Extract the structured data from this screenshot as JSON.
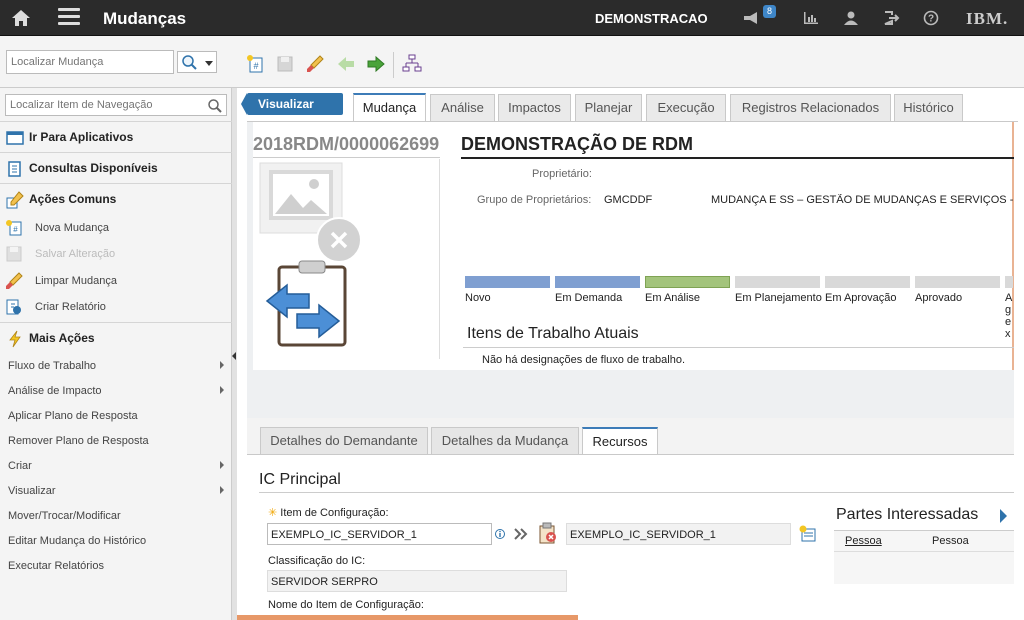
{
  "topbar": {
    "app_title": "Mudanças",
    "user_context": "DEMONSTRACAO",
    "notification_count": "8",
    "brand": "IBM."
  },
  "toolbar": {
    "search_placeholder": "Localizar Mudança"
  },
  "sidebar": {
    "search_placeholder": "Localizar Item de Navegação",
    "sections": {
      "go_to_apps": "Ir Para Aplicativos",
      "queries": "Consultas Disponíveis",
      "common_actions": "Ações Comuns",
      "more_actions": "Mais Ações"
    },
    "common_items": [
      "Nova Mudança",
      "Salvar Alteração",
      "Limpar Mudança",
      "Criar Relatório"
    ],
    "more_items": [
      {
        "label": "Fluxo de Trabalho",
        "submenu": true
      },
      {
        "label": "Análise de Impacto",
        "submenu": true
      },
      {
        "label": "Aplicar Plano de Resposta",
        "submenu": false
      },
      {
        "label": "Remover Plano de Resposta",
        "submenu": false
      },
      {
        "label": "Criar",
        "submenu": true
      },
      {
        "label": "Visualizar",
        "submenu": true
      },
      {
        "label": "Mover/Trocar/Modificar",
        "submenu": false
      },
      {
        "label": "Editar Mudança do Histórico",
        "submenu": false
      },
      {
        "label": "Executar Relatórios",
        "submenu": false
      }
    ]
  },
  "main": {
    "back_button": "Visualizar Lista",
    "tabs": [
      "Mudança",
      "Análise",
      "Impactos",
      "Planejar",
      "Execução",
      "Registros Relacionados",
      "Histórico"
    ],
    "active_tab": "Mudança",
    "record_id": "2018RDM/0000062699",
    "record_title": "DEMONSTRAÇÃO DE RDM",
    "owner_label": "Proprietário:",
    "owner_value": "",
    "owner_group_label": "Grupo de Proprietários:",
    "owner_group_value": "GMCDDF",
    "owner_group_desc": "MUDANÇA E SS – GESTÃO DE MUDANÇAS E SERVIÇOS -",
    "status_steps": [
      {
        "label": "Novo",
        "color": "#7f9fd1"
      },
      {
        "label": "Em Demanda",
        "color": "#7f9fd1"
      },
      {
        "label": "Em Análise",
        "color": "#a3c47c"
      },
      {
        "label": "Em Planejamento",
        "color": "#d9d9d9"
      },
      {
        "label": "Em Aprovação",
        "color": "#d9d9d9"
      },
      {
        "label": "Aprovado",
        "color": "#d9d9d9"
      },
      {
        "label": "Ag ex",
        "color": "#d9d9d9"
      }
    ],
    "work_items_title": "Itens de Trabalho Atuais",
    "work_items_empty": "Não há designações de fluxo de trabalho.",
    "sub_tabs": [
      "Detalhes do Demandante",
      "Detalhes da Mudança",
      "Recursos"
    ],
    "active_sub_tab": "Recursos",
    "ic_section_title": "IC Principal",
    "ci_label": "Item de Configuração:",
    "ci_value": "EXEMPLO_IC_SERVIDOR_1",
    "ci_desc": "EXEMPLO_IC_SERVIDOR_1",
    "ci_class_label": "Classificação do IC:",
    "ci_class_value": "SERVIDOR SERPRO",
    "ci_name_label": "Nome do Item de Configuração:",
    "stakeholders_title": "Partes Interessadas",
    "stakeholders_cols": [
      "Pessoa",
      "Pessoa"
    ]
  }
}
